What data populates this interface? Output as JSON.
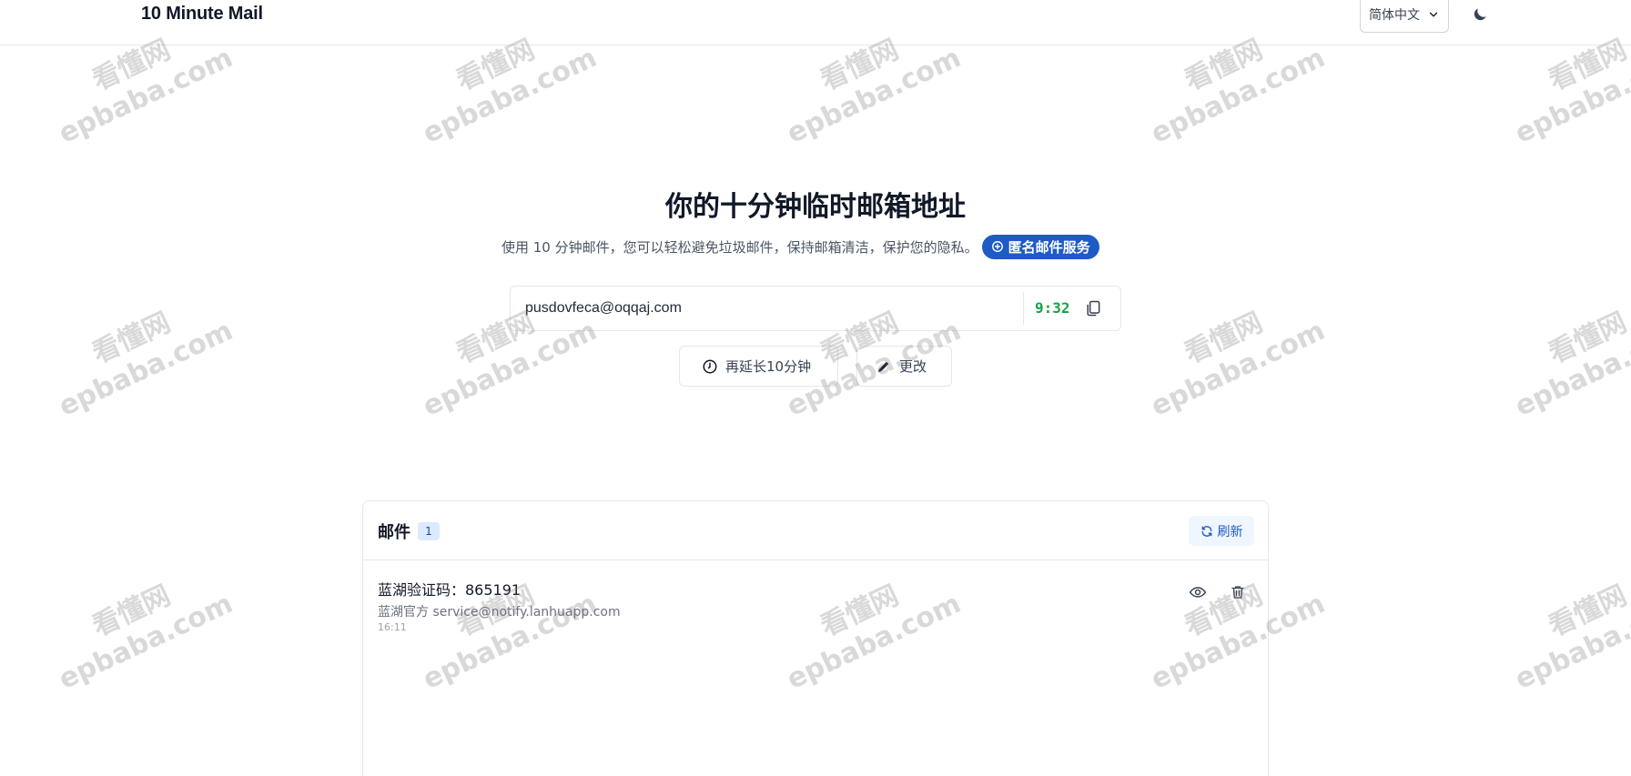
{
  "header": {
    "brand": "10 Minute Mail",
    "language": "简体中文"
  },
  "hero": {
    "title": "你的十分钟临时邮箱地址",
    "subtitle": "使用 10 分钟邮件，您可以轻松避免垃圾邮件，保持邮箱清洁，保护您的隐私。",
    "badge_label": "匿名邮件服务"
  },
  "address": {
    "email": "pusdovfeca@oqqaj.com",
    "timer": "9:32"
  },
  "actions": {
    "extend_label": "再延长10分钟",
    "change_label": "更改"
  },
  "inbox": {
    "title": "邮件",
    "count": "1",
    "refresh_label": "刷新",
    "messages": [
      {
        "subject": "蓝湖验证码：865191",
        "from": "蓝湖官方 service@notify.lanhuapp.com",
        "time": "16:11"
      }
    ]
  },
  "watermark": {
    "line1": "看懂网",
    "line2": "epbaba.com"
  },
  "colors": {
    "accent": "#1e5bc6",
    "timer": "#16a34a",
    "badge_bg": "#dbeafe"
  }
}
